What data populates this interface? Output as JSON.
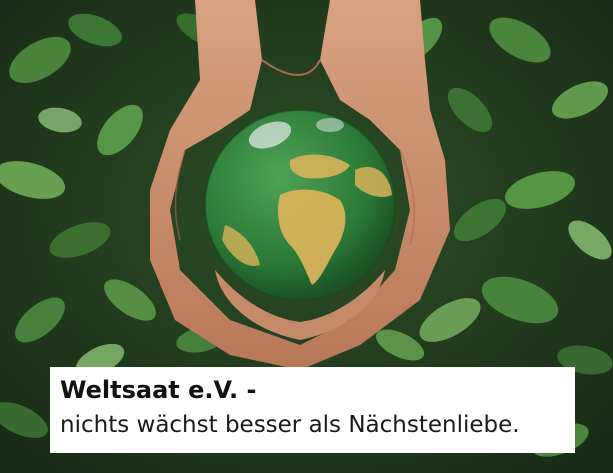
{
  "caption": {
    "title": "Weltsaat e.V. -",
    "subtitle": "nichts wächst besser als Nächstenliebe."
  },
  "colors": {
    "foliage_dark": "#1f3a1c",
    "foliage_light": "#5f9a4a",
    "globe_ocean": "#2f7d3a",
    "globe_land": "#d8b35a",
    "skin": "#c98e6e",
    "caption_bg": "#ffffff"
  }
}
